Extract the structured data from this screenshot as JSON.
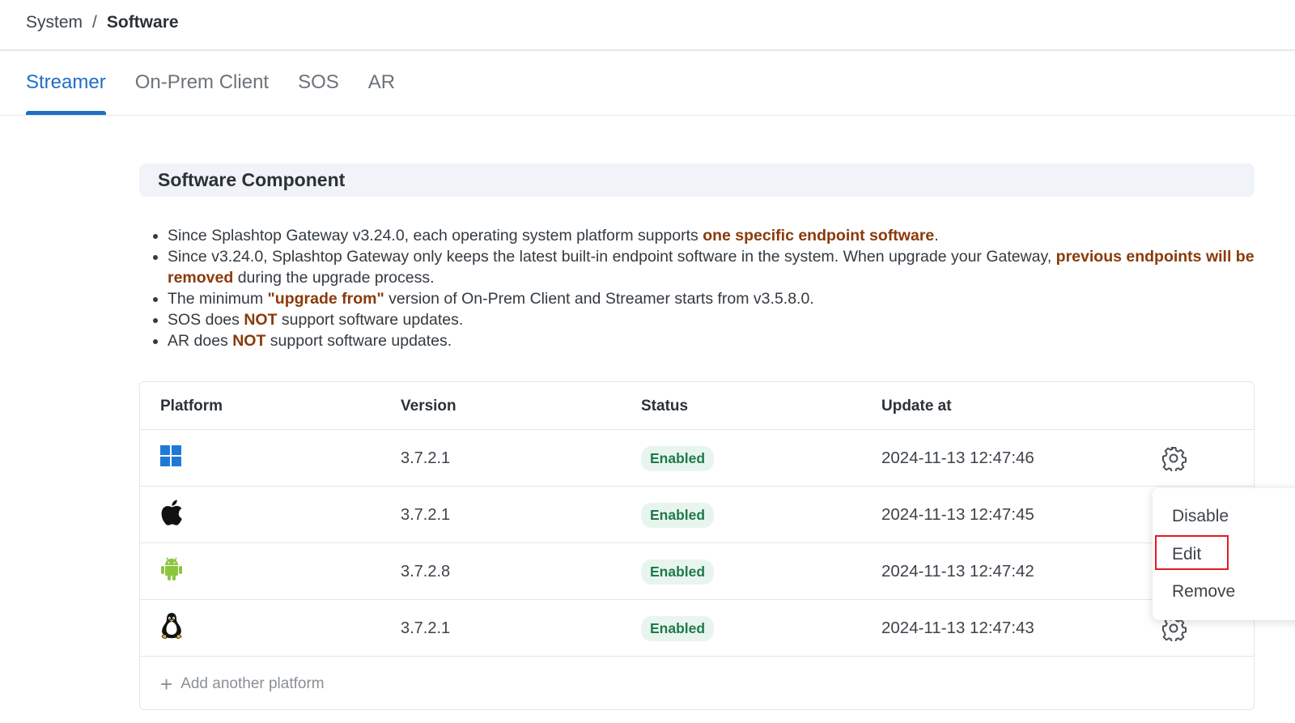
{
  "breadcrumb": {
    "root": "System",
    "separator": "/",
    "current": "Software"
  },
  "tabs": [
    {
      "label": "Streamer",
      "active": true
    },
    {
      "label": "On-Prem Client",
      "active": false
    },
    {
      "label": "SOS",
      "active": false
    },
    {
      "label": "AR",
      "active": false
    }
  ],
  "section": {
    "title": "Software Component"
  },
  "notes": [
    {
      "a": "Since Splashtop Gateway v3.24.0, each operating system platform supports ",
      "b": "one specific endpoint software",
      "c": "."
    },
    {
      "a": "Since v3.24.0, Splashtop Gateway only keeps the latest built-in endpoint software in the system. When upgrade your Gateway, ",
      "b": "previous endpoints will be removed",
      "c": " during the upgrade process."
    },
    {
      "a": "The minimum ",
      "b": "\"upgrade from\"",
      "c": " version of On-Prem Client and Streamer starts from v3.5.8.0."
    },
    {
      "a": "SOS does ",
      "b": "NOT",
      "c": " support software updates."
    },
    {
      "a": "AR does ",
      "b": "NOT",
      "c": " support software updates."
    }
  ],
  "table": {
    "columns": {
      "platform": "Platform",
      "version": "Version",
      "status": "Status",
      "update_at": "Update at"
    },
    "rows": [
      {
        "platform_icon": "windows-icon",
        "version": "3.7.2.1",
        "status": "Enabled",
        "update_at": "2024-11-13 12:47:46"
      },
      {
        "platform_icon": "apple-icon",
        "version": "3.7.2.1",
        "status": "Enabled",
        "update_at": "2024-11-13 12:47:45"
      },
      {
        "platform_icon": "android-icon",
        "version": "3.7.2.8",
        "status": "Enabled",
        "update_at": "2024-11-13 12:47:42"
      },
      {
        "platform_icon": "linux-icon",
        "version": "3.7.2.1",
        "status": "Enabled",
        "update_at": "2024-11-13 12:47:43"
      }
    ],
    "add_label": "Add another platform"
  },
  "menu": {
    "disable": "Disable",
    "edit": "Edit",
    "remove": "Remove"
  },
  "colors": {
    "accent": "#1f6fc5",
    "highlight_text": "#8a3a0a",
    "badge_bg": "#e8f5ee",
    "badge_text": "#1f7a4a",
    "annotation": "#e01b24"
  }
}
